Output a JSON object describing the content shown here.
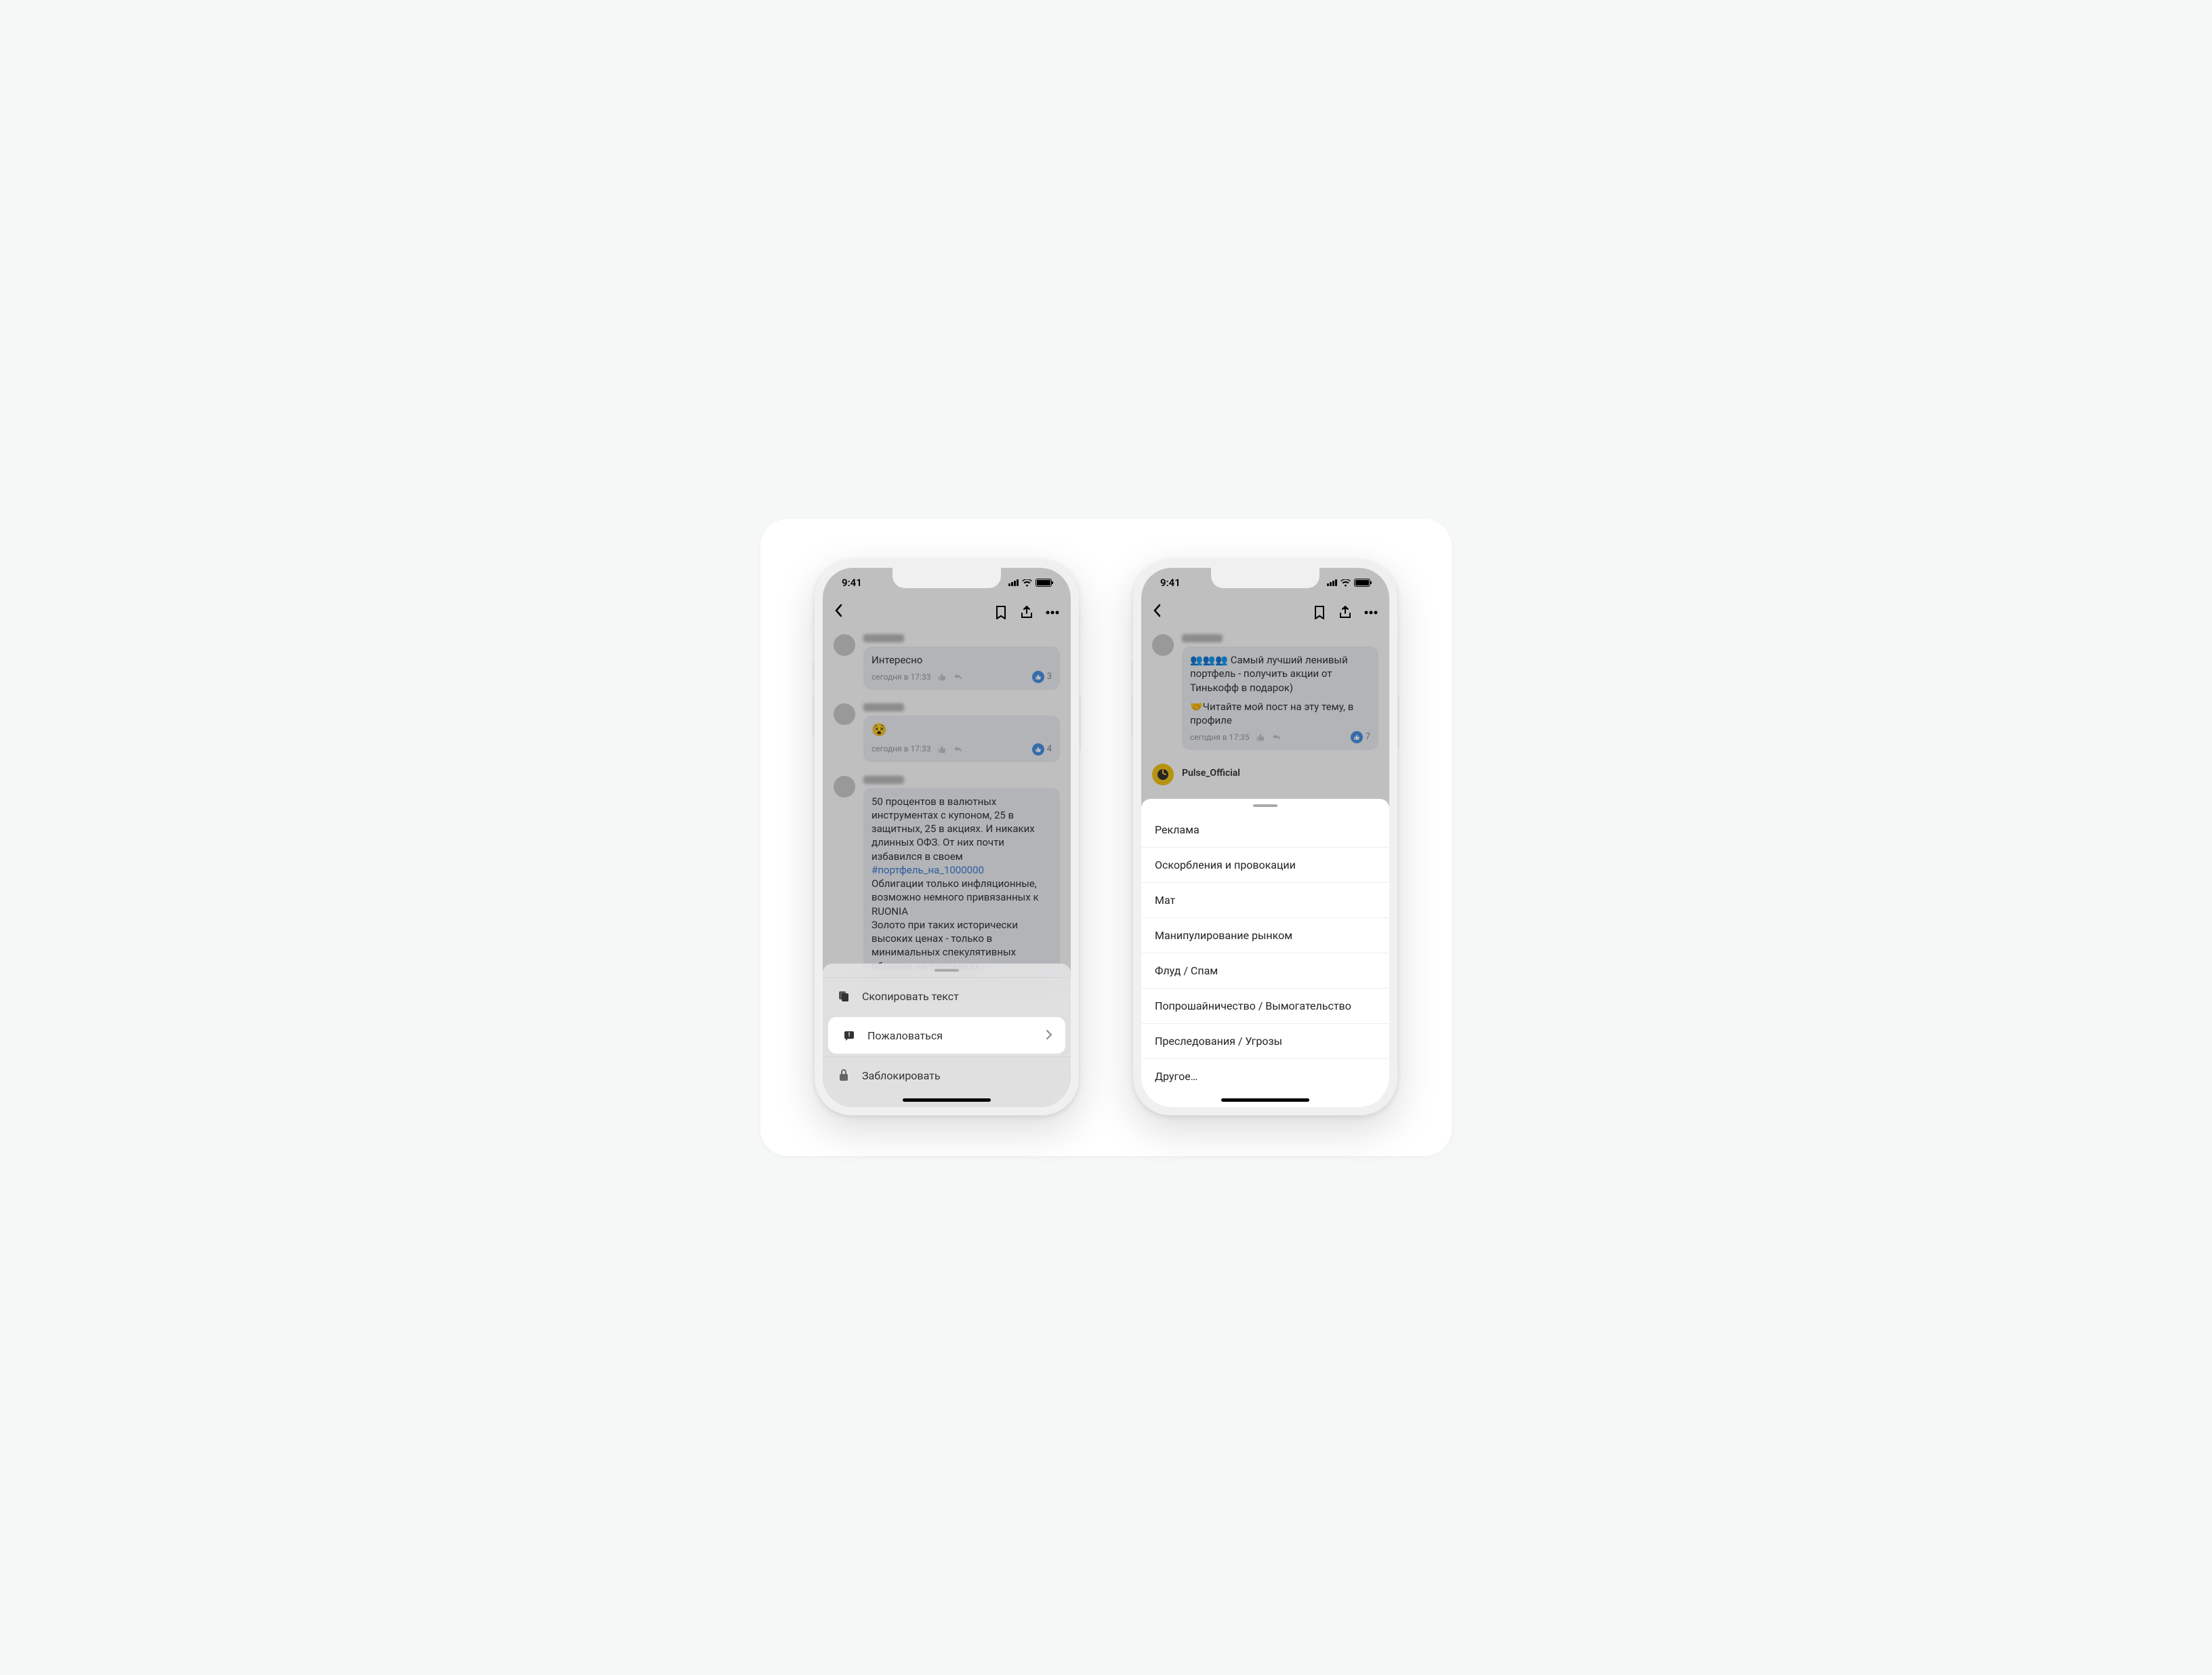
{
  "statusbar": {
    "time": "9:41"
  },
  "left": {
    "comments": [
      {
        "text": "Интересно",
        "time": "сегодня в 17:33",
        "likes": "3"
      },
      {
        "emoji": "😵",
        "time": "сегодня в 17:33",
        "likes": "4"
      },
      {
        "text_pre": "50 процентов в валютных инструментах с купоном, 25 в защитных, 25 в акциях. И никаких длинных ОФЗ. От них почти избавился в своем",
        "hashtag": "#портфель_на_1000000",
        "text_mid": "Облигации только инфляционные, возможно немного привязанных к RUONIA",
        "text_end": "Золото при таких исторически высоких ценах - только в минимальных спекулятивных объемах на просадках"
      }
    ],
    "sheet": {
      "copy": "Скопировать текст",
      "report": "Пожаловаться",
      "block": "Заблокировать"
    }
  },
  "right": {
    "comment": {
      "text1": "👥👥👥 Самый лучший ленивый портфель - получить акции от Тинькофф в подарок)",
      "text2": "🤝Читайте мой пост на эту тему, в профиле",
      "time": "сегодня в 17:35",
      "likes": "7"
    },
    "pulse_label": "Pulse_Official",
    "report_options": [
      "Реклама",
      "Оскорбления и провокации",
      "Мат",
      "Манипулирование рынком",
      "Флуд / Спам",
      "Попрошайничество / Вымогательство",
      "Преследования / Угрозы",
      "Другое…"
    ]
  }
}
